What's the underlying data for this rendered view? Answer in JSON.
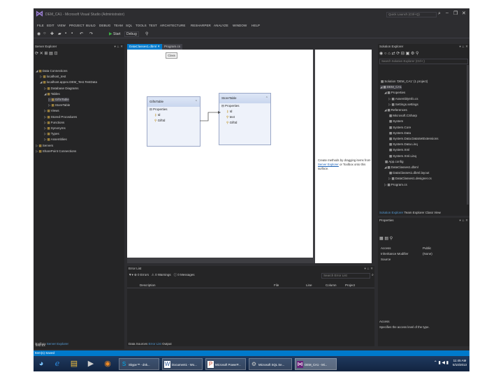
{
  "window": {
    "title": "DEM_CA1 - Microsoft Visual Studio (Administrator)",
    "quick_launch_placeholder": "Quick Launch (Ctrl+Q)",
    "minimize": "–",
    "restore": "❐",
    "close": "✕"
  },
  "menu": [
    "FILE",
    "EDIT",
    "VIEW",
    "PROJECT",
    "BUILD",
    "DEBUG",
    "TEAM",
    "SQL",
    "TOOLS",
    "TEST",
    "ARCHITECTURE",
    "RESHARPER",
    "ANALYZE",
    "WINDOW",
    "HELP"
  ],
  "toolbar": {
    "start_label": "Start",
    "config_label": "Debug"
  },
  "server_explorer": {
    "title": "Server Explorer",
    "items": [
      {
        "label": "Data Connections",
        "indent": 0,
        "arrow": "◢"
      },
      {
        "label": "localhost_test",
        "indent": 1,
        "arrow": "▷"
      },
      {
        "label": "localhost.appex.DEM_Test.TestData",
        "indent": 1,
        "arrow": "◢"
      },
      {
        "label": "Database Diagrams",
        "indent": 2,
        "arrow": "▷"
      },
      {
        "label": "Tables",
        "indent": 2,
        "arrow": "◢"
      },
      {
        "label": "GiftsTable",
        "indent": 3,
        "arrow": "▷",
        "selected": true
      },
      {
        "label": "StoreTable",
        "indent": 3,
        "arrow": "▷"
      },
      {
        "label": "Views",
        "indent": 2,
        "arrow": "▷"
      },
      {
        "label": "Stored Procedures",
        "indent": 2,
        "arrow": "▷"
      },
      {
        "label": "Functions",
        "indent": 2,
        "arrow": "▷"
      },
      {
        "label": "Synonyms",
        "indent": 2,
        "arrow": "▷"
      },
      {
        "label": "Types",
        "indent": 2,
        "arrow": "▷"
      },
      {
        "label": "Assemblies",
        "indent": 2,
        "arrow": "▷"
      },
      {
        "label": "Servers",
        "indent": 0,
        "arrow": "▷"
      },
      {
        "label": "SharePoint Connections",
        "indent": 0,
        "arrow": "▷"
      }
    ],
    "footer": {
      "toolbox": "Toolbox",
      "server_explorer": "Server Explorer",
      "tab3": "Test Ex"
    }
  },
  "tabs": [
    {
      "label": "DataClasses1.dbml",
      "active": true
    },
    {
      "label": "Program.cs",
      "active": false
    }
  ],
  "designer": {
    "tooltip": "Class",
    "entities": [
      {
        "title": "GiftsTable",
        "props_label": "Properties",
        "fields": [
          "Id",
          "GiftId"
        ]
      },
      {
        "title": "StoreTable",
        "props_label": "Properties",
        "fields": [
          "Id",
          "text",
          "GiftId"
        ]
      }
    ],
    "side_text": "Create methods by dragging items from",
    "side_link": "Server Explorer",
    "side_text_end": "or Toolbox onto this surface."
  },
  "error_list": {
    "title": "Error List",
    "errors_label": "0 Errors",
    "warnings_label": "0 Warnings",
    "messages_label": "0 Messages",
    "search_placeholder": "Search Error List",
    "columns": [
      "Description",
      "File",
      "Line",
      "Column",
      "Project"
    ]
  },
  "solution_explorer": {
    "title": "Solution Explorer",
    "search_placeholder": "Search Solution Explorer (Ctrl+;)",
    "items": [
      {
        "label": "Solution 'DEM_CA1' (1 project)",
        "indent": 0,
        "arrow": ""
      },
      {
        "label": "DEM_CA1",
        "indent": 0,
        "arrow": "◢",
        "selected": true
      },
      {
        "label": "Properties",
        "indent": 1,
        "arrow": "◢"
      },
      {
        "label": "AssemblyInfo.cs",
        "indent": 2,
        "arrow": "▷"
      },
      {
        "label": "Settings.settings",
        "indent": 2,
        "arrow": "▷"
      },
      {
        "label": "References",
        "indent": 1,
        "arrow": "◢"
      },
      {
        "label": "Microsoft.CSharp",
        "indent": 2,
        "arrow": ""
      },
      {
        "label": "System",
        "indent": 2,
        "arrow": ""
      },
      {
        "label": "System.Core",
        "indent": 2,
        "arrow": ""
      },
      {
        "label": "System.Data",
        "indent": 2,
        "arrow": ""
      },
      {
        "label": "System.Data.DataSetExtensions",
        "indent": 2,
        "arrow": ""
      },
      {
        "label": "System.Data.Linq",
        "indent": 2,
        "arrow": ""
      },
      {
        "label": "System.Xml",
        "indent": 2,
        "arrow": ""
      },
      {
        "label": "System.Xml.Linq",
        "indent": 2,
        "arrow": ""
      },
      {
        "label": "App.config",
        "indent": 1,
        "arrow": ""
      },
      {
        "label": "DataClasses1.dbml",
        "indent": 1,
        "arrow": "◢"
      },
      {
        "label": "DataClasses1.dbml.layout",
        "indent": 2,
        "arrow": ""
      },
      {
        "label": "DataClasses1.designer.cs",
        "indent": 2,
        "arrow": "▷"
      },
      {
        "label": "Program.cs",
        "indent": 1,
        "arrow": "▷"
      }
    ],
    "bottom_tabs": [
      "Solution Explorer",
      "Team Explorer",
      "Class View"
    ]
  },
  "properties": {
    "title": "Properties",
    "rows": [
      {
        "name": "Access",
        "value": "Public"
      },
      {
        "name": "Inheritance Modifier",
        "value": "(None)"
      },
      {
        "name": "Source",
        "value": ""
      }
    ],
    "desc_title": "Access",
    "desc": "Specifies the access level of the type."
  },
  "bottom_panel_tabs": [
    "Data Sources",
    "Error List",
    "Output"
  ],
  "status": "Item(s) Saved",
  "taskbar": {
    "tasks": [
      "Skype™ - dnk...",
      "Document1 - Wo...",
      "Microsoft PowerP...",
      "Microsoft SQL Se...",
      "DEM_CA1 - Mi..."
    ],
    "time": "11:45 AM",
    "date": "5/10/2013"
  },
  "colors": {
    "vs_dark": "#2d2d30",
    "panel": "#252526",
    "accent": "#007acc",
    "link": "#569cd6"
  }
}
